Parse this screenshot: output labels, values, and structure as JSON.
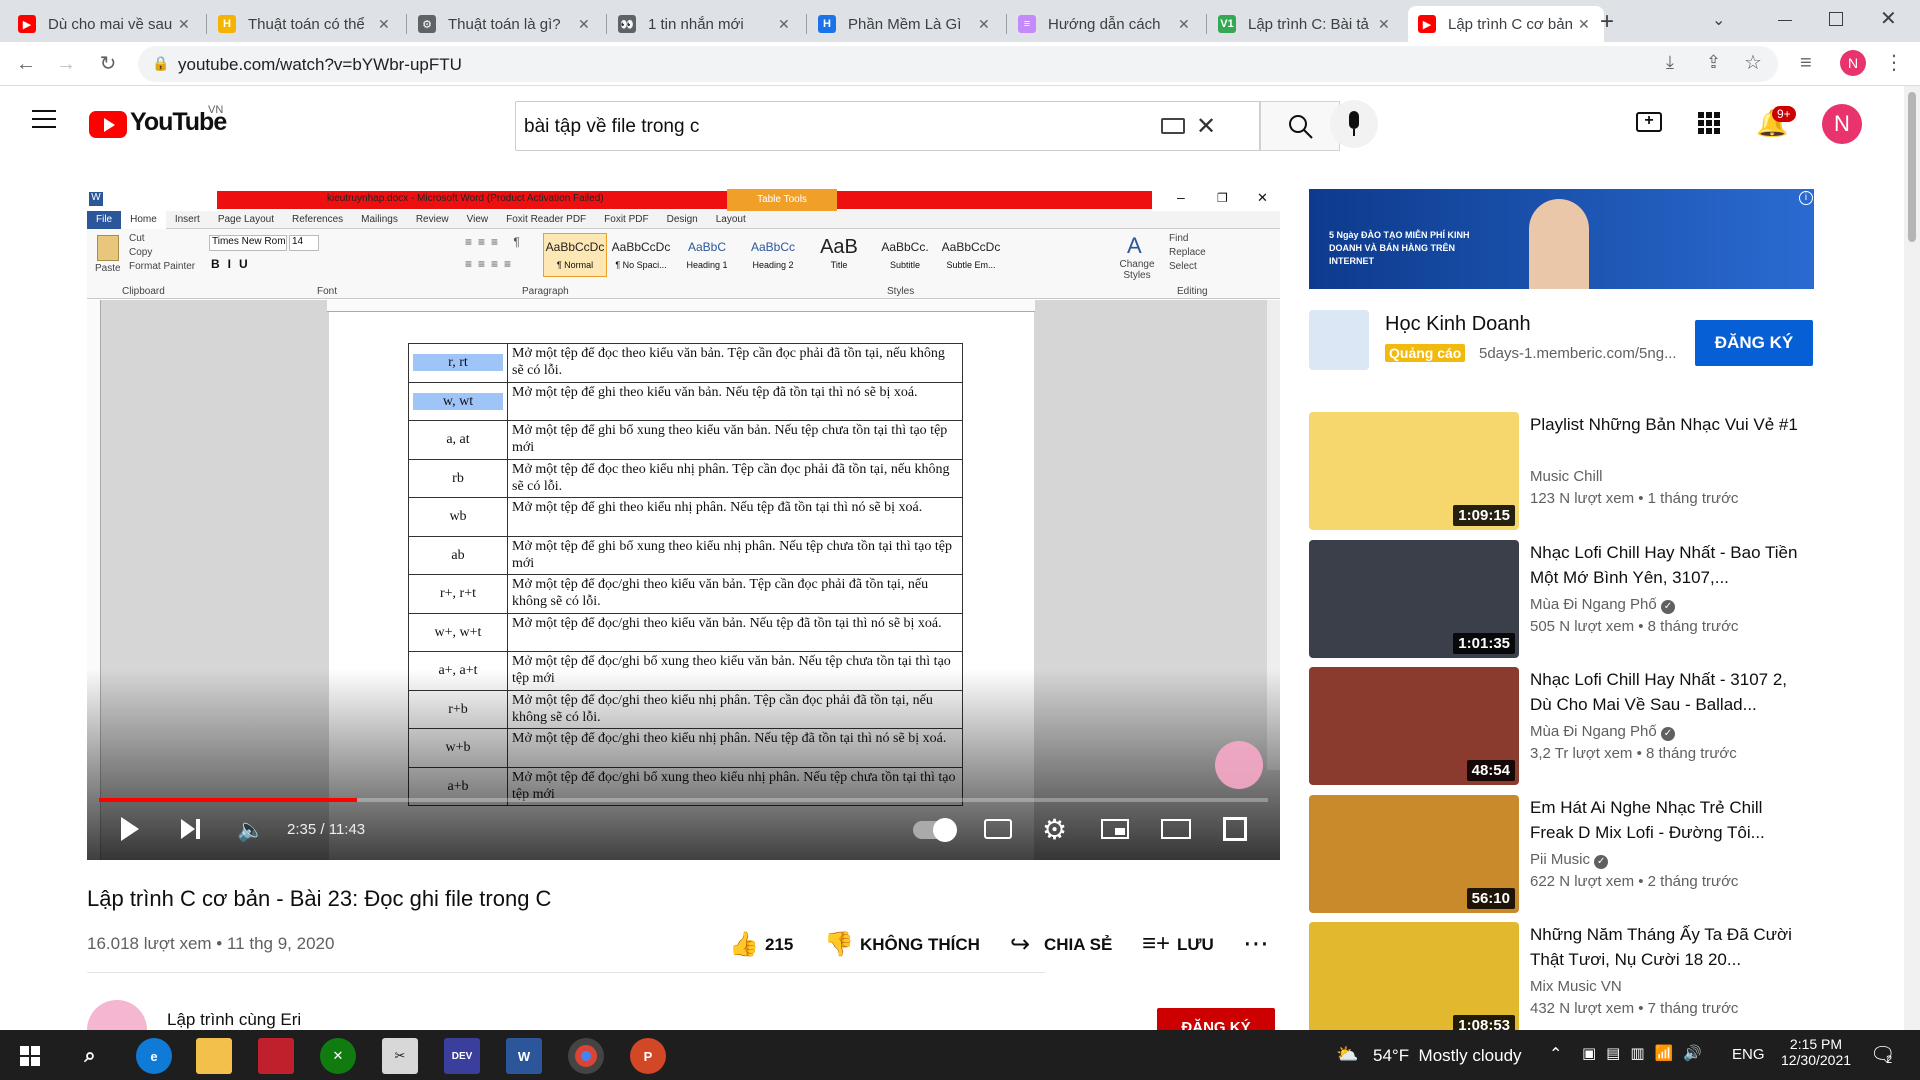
{
  "browser": {
    "tabs": [
      {
        "title": "Dù cho mai về sau",
        "fav_color": "#ff0000",
        "fav_glyph": "▶"
      },
      {
        "title": "Thuật toán có thể",
        "fav_color": "#f4b400",
        "fav_glyph": "H"
      },
      {
        "title": "Thuật toán là gì?",
        "fav_color": "#5f6368",
        "fav_glyph": "⚙"
      },
      {
        "title": "1 tin nhắn mới",
        "fav_color": "#5f6368",
        "fav_glyph": "👀"
      },
      {
        "title": "Phần Mềm Là Gì",
        "fav_color": "#1a73e8",
        "fav_glyph": "H"
      },
      {
        "title": "Hướng dẫn cách",
        "fav_color": "#c58af9",
        "fav_glyph": "≡"
      },
      {
        "title": "Lập trình C: Bài tả",
        "fav_color": "#34a853",
        "fav_glyph": "V1"
      },
      {
        "title": "Lập trình C cơ bản",
        "fav_color": "#ff0000",
        "fav_glyph": "▶"
      }
    ],
    "new_tab_glyph": "+",
    "url": "youtube.com/watch?v=bYWbr-upFTU",
    "profile_initial": "N"
  },
  "youtube": {
    "logo_text": "YouTube",
    "region": "VN",
    "search_value": "bài tập về file trong c",
    "notif_badge": "9+",
    "avatar_initial": "N"
  },
  "player": {
    "doc_title": "kieutruynhap.docx - Microsoft Word (Product Activation Failed)",
    "table_tools": "Table Tools",
    "word_tabs": [
      "File",
      "Home",
      "Insert",
      "Page Layout",
      "References",
      "Mailings",
      "Review",
      "View",
      "Foxit Reader PDF",
      "Foxit PDF",
      "Design",
      "Layout"
    ],
    "ribbon_groups": [
      "Clipboard",
      "Font",
      "Paragraph",
      "Styles",
      "Editing"
    ],
    "clipboard_items": [
      "Cut",
      "Copy",
      "Format Painter",
      "Paste"
    ],
    "font_name": "Times New Rom",
    "font_size": "14",
    "styles": [
      {
        "sample": "AaBbCcDc",
        "label": "¶ Normal"
      },
      {
        "sample": "AaBbCcDc",
        "label": "¶ No Spaci..."
      },
      {
        "sample": "AaBbC",
        "label": "Heading 1"
      },
      {
        "sample": "AaBbCc",
        "label": "Heading 2"
      },
      {
        "sample": "AaB",
        "label": "Title"
      },
      {
        "sample": "AaBbCc.",
        "label": "Subtitle"
      },
      {
        "sample": "AaBbCcDc",
        "label": "Subtle Em..."
      }
    ],
    "change_styles": "Change Styles",
    "editing_items": [
      "Find",
      "Replace",
      "Select"
    ],
    "table_rows": [
      {
        "mode": "r, rt",
        "desc": "Mở một tệp để đọc theo kiểu văn bản. Tệp cần đọc phải đã tồn tại, nếu không sẽ có lỗi.",
        "highlight": true
      },
      {
        "mode": "w, wt",
        "desc": "Mở một tệp để ghi theo kiểu văn bản. Nếu tệp đã tồn tại thì nó sẽ bị xoá.",
        "highlight": true
      },
      {
        "mode": "a, at",
        "desc": "Mở một tệp để ghi bổ xung theo kiểu văn bản. Nếu tệp chưa tồn tại thì tạo tệp mới",
        "highlight": false
      },
      {
        "mode": "rb",
        "desc": "Mở một tệp để đọc theo kiểu nhị phân. Tệp cần đọc phải đã tồn tại, nếu không sẽ có lỗi.",
        "highlight": false
      },
      {
        "mode": "wb",
        "desc": "Mở một tệp để ghi theo kiểu nhị phân. Nếu tệp đã tồn tại thì nó sẽ bị xoá.",
        "highlight": false
      },
      {
        "mode": "ab",
        "desc": "Mở một tệp để ghi bổ xung theo kiểu nhị phân. Nếu tệp chưa tồn tại thì tạo tệp mới",
        "highlight": false
      },
      {
        "mode": "r+, r+t",
        "desc": "Mở một tệp để đọc/ghi theo kiểu văn bản. Tệp cần đọc phải đã tồn tại, nếu không sẽ có lỗi.",
        "highlight": false
      },
      {
        "mode": "w+, w+t",
        "desc": "Mở một tệp để đọc/ghi theo kiểu văn bản. Nếu tệp đã tồn tại thì nó sẽ bị xoá.",
        "highlight": false
      },
      {
        "mode": "a+, a+t",
        "desc": "Mở một tệp để đọc/ghi bổ xung theo kiểu văn bản. Nếu tệp chưa tồn tại thì tạo tệp mới",
        "highlight": false
      },
      {
        "mode": "r+b",
        "desc": "Mở một tệp để đọc/ghi theo kiểu nhị phân. Tệp cần đọc phải đã tồn tại, nếu không sẽ có lỗi.",
        "highlight": false
      },
      {
        "mode": "w+b",
        "desc": "Mở một tệp để đọc/ghi theo kiểu nhị phân. Nếu tệp đã tồn tại thì nó sẽ bị xoá.",
        "highlight": false
      },
      {
        "mode": "a+b",
        "desc": "Mở một tệp để đọc/ghi bổ xung theo kiểu nhị phân. Nếu tệp chưa tồn tại thì tạo tệp mới",
        "highlight": false
      }
    ],
    "time_current": "2:35",
    "time_total": "11:43",
    "progress": 0.2205
  },
  "video": {
    "title": "Lập trình C cơ bản - Bài 23: Đọc ghi file trong C",
    "views_date": "16.018 lượt xem • 11 thg 9, 2020",
    "likes": "215",
    "dislike_label": "KHÔNG THÍCH",
    "share_label": "CHIA SẺ",
    "save_label": "LƯU",
    "channel": "Lập trình cùng Eri",
    "subscribe_label": "ĐĂNG KÝ"
  },
  "ad": {
    "banner_text": "5 Ngày ĐÀO TẠO MIỄN PHÍ KINH DOANH VÀ BÁN HÀNG TRÊN INTERNET",
    "title": "Học Kinh Doanh",
    "badge": "Quảng cáo",
    "url": "5days-1.memberic.com/5ng...",
    "cta": "ĐĂNG KÝ"
  },
  "recommendations": [
    {
      "title": "Playlist Những Bản Nhạc Vui Vẻ #1",
      "channel": "Music Chill",
      "meta": "123 N lượt xem • 1 tháng trước",
      "duration": "1:09:15",
      "verified": false,
      "thumb": "#f5d76e"
    },
    {
      "title": "Nhạc Lofi Chill Hay Nhất - Bao Tiền Một Mớ Bình Yên, 3107,...",
      "channel": "Mùa Đi Ngang Phố",
      "meta": "505 N lượt xem • 8 tháng trước",
      "duration": "1:01:35",
      "verified": true,
      "thumb": "#3a3f4a"
    },
    {
      "title": "Nhạc Lofi Chill Hay Nhất - 3107 2, Dù Cho Mai Về Sau - Ballad...",
      "channel": "Mùa Đi Ngang Phố",
      "meta": "3,2 Tr lượt xem • 8 tháng trước",
      "duration": "48:54",
      "verified": true,
      "thumb": "#8a3b2e"
    },
    {
      "title": "Em Hát Ai Nghe Nhạc Trẻ Chill Freak D Mix Lofi - Đường Tôi...",
      "channel": "Pii Music",
      "meta": "622 N lượt xem • 2 tháng trước",
      "duration": "56:10",
      "verified": true,
      "thumb": "#c98a2c"
    },
    {
      "title": "Những Năm Tháng Ấy Ta Đã Cười Thật Tươi, Nụ Cười 18 20...",
      "channel": "Mix Music VN",
      "meta": "432 N lượt xem • 7 tháng trước",
      "duration": "1:08:53",
      "verified": false,
      "thumb": "#e2b92e"
    }
  ],
  "taskbar": {
    "weather": "54°F  Mostly cloudy",
    "lang": "ENG",
    "time": "2:15 PM",
    "date": "12/30/2021",
    "notif_count": "2"
  }
}
